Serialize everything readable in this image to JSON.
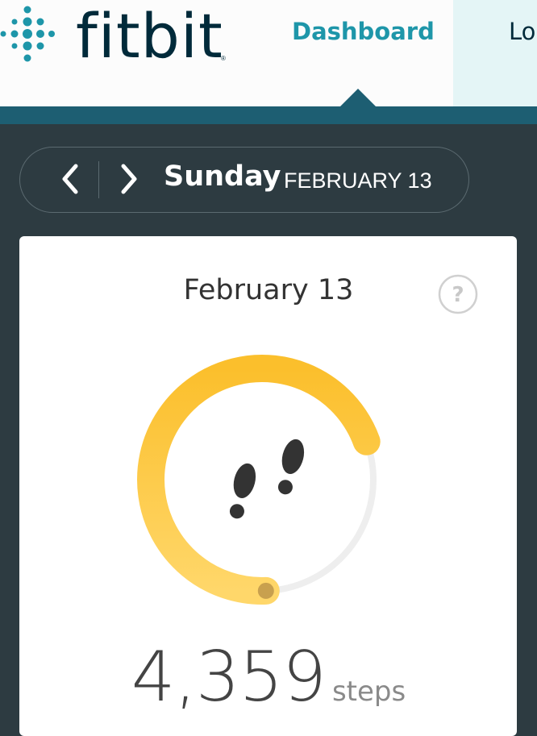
{
  "header": {
    "logo_text": "fitbit",
    "logo_registered": "®",
    "nav": {
      "dashboard_label": "Dashboard",
      "log_label": "Log"
    }
  },
  "date_nav": {
    "day": "Sunday",
    "date": "FEBRUARY 13"
  },
  "steps_card": {
    "title": "February 13",
    "help_icon": "question-mark-icon",
    "progress_fraction": 0.75,
    "value": "4,359",
    "unit": "steps"
  },
  "colors": {
    "accent": "#1e96a9",
    "ring_start": "#fbbf2c",
    "ring_end": "#ffd76a",
    "ring_track": "#eeeeee",
    "background": "#2d3b41"
  }
}
